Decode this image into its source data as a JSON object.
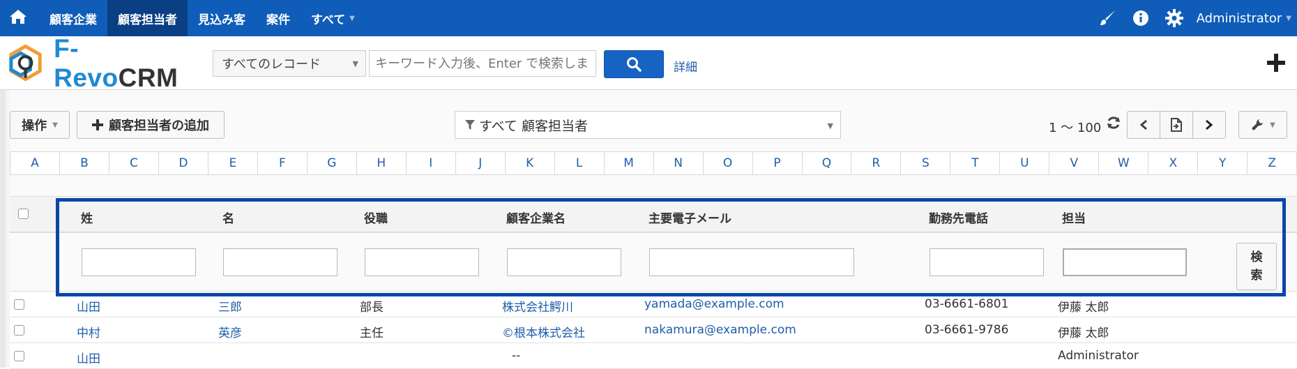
{
  "topnav": {
    "menu": [
      {
        "label": "顧客企業",
        "active": false
      },
      {
        "label": "顧客担当者",
        "active": true
      },
      {
        "label": "見込み客",
        "active": false
      },
      {
        "label": "案件",
        "active": false
      },
      {
        "label": "すべて",
        "active": false
      }
    ],
    "user": "Administrator",
    "icons": [
      "home-icon",
      "brush-icon",
      "info-icon",
      "gear-icon"
    ]
  },
  "header": {
    "brand_part1": "F-Revo",
    "brand_part2": "CRM",
    "record_select": "すべてのレコード",
    "search_placeholder": "キーワード入力後、Enter で検索します",
    "detail_link": "詳細"
  },
  "toolbar": {
    "actions_label": "操作",
    "add_contact_label": "顧客担当者の追加",
    "filter_label": "すべて 顧客担当者",
    "range": "1 ～ 100"
  },
  "alphabet": [
    "A",
    "B",
    "C",
    "D",
    "E",
    "F",
    "G",
    "H",
    "I",
    "J",
    "K",
    "L",
    "M",
    "N",
    "O",
    "P",
    "Q",
    "R",
    "S",
    "T",
    "U",
    "V",
    "W",
    "X",
    "Y",
    "Z"
  ],
  "table": {
    "columns": [
      "姓",
      "名",
      "役職",
      "顧客企業名",
      "主要電子メール",
      "勤務先電話",
      "担当"
    ],
    "search_button": "検\n索",
    "rows": [
      {
        "last": "山田",
        "first": "三郎",
        "title": "部長",
        "company": "株式会社鰐川",
        "email": "yamada@example.com",
        "phone": "03-6661-6801",
        "owner": "伊藤 太郎"
      },
      {
        "last": "中村",
        "first": "英彦",
        "title": "主任",
        "company": "©根本株式会社",
        "email": "nakamura@example.com",
        "phone": "03-6661-9786",
        "owner": "伊藤 太郎"
      },
      {
        "last": "山田",
        "first": "",
        "title": "",
        "company": "--",
        "email": "",
        "phone": "",
        "owner": "Administrator"
      }
    ]
  },
  "colors": {
    "nav_bg": "#0f5db8",
    "nav_active": "#0a3f84",
    "link": "#1f5ea8",
    "highlight": "#0a47a9"
  }
}
